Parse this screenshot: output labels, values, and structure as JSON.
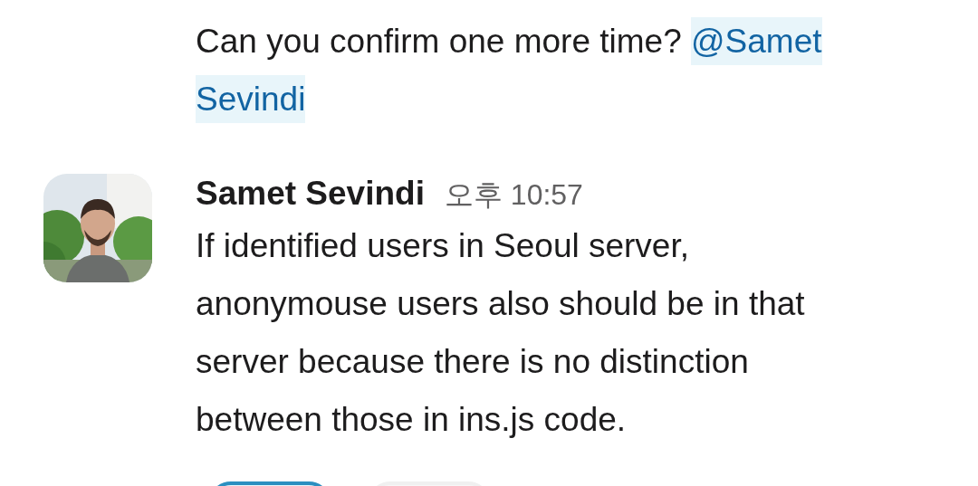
{
  "messages": [
    {
      "text_before": "Can you confirm one more time? ",
      "mention_lines": [
        "@Samet",
        "Sevindi"
      ]
    },
    {
      "author": "Samet Sevindi",
      "time": "오후 10:57",
      "text": "If identified users in Seoul server,\nanonymouse users also should be in that\nserver because there is no distinction\nbetween those in ins.js code."
    }
  ],
  "reactions": [
    {
      "selected": true
    },
    {
      "selected": false
    }
  ]
}
